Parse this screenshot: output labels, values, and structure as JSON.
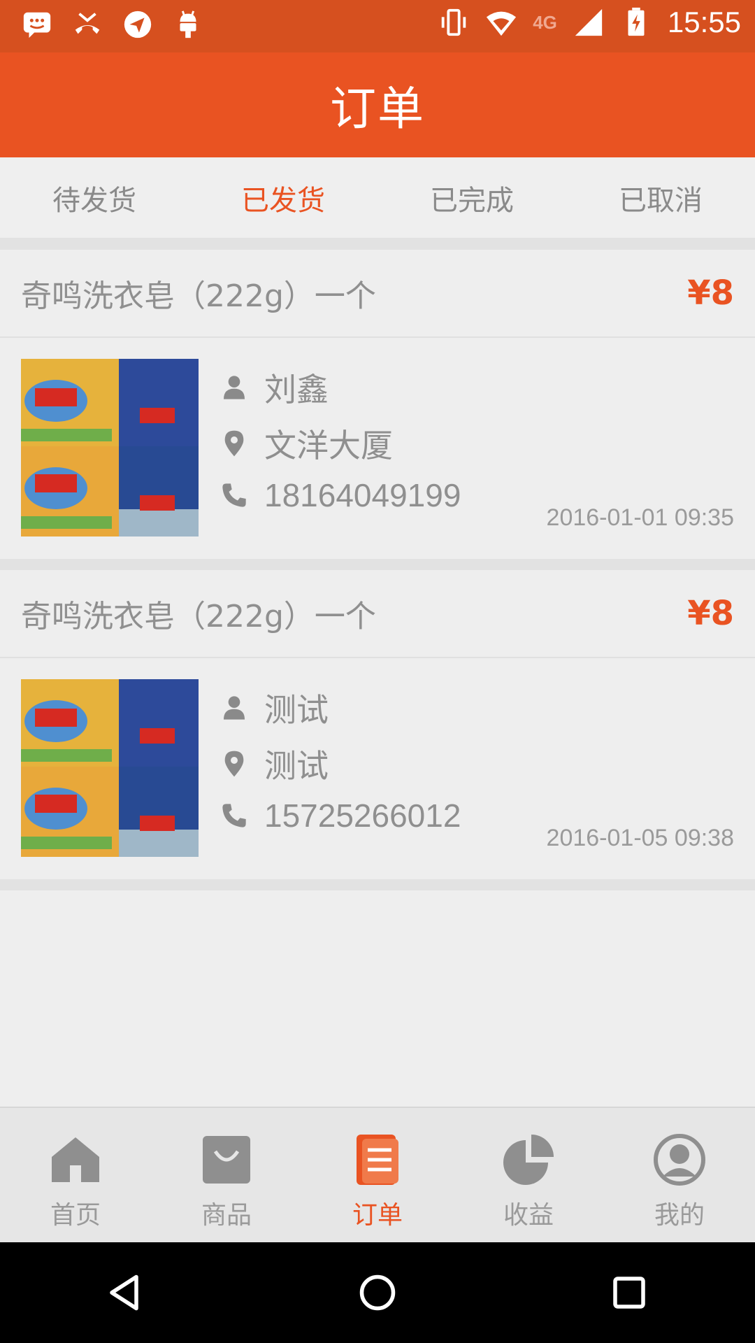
{
  "status_bar": {
    "time": "15:55",
    "network": "4G",
    "left_icons": [
      "message-icon",
      "missed-call-icon",
      "send-icon",
      "android-icon"
    ],
    "right_icons": [
      "vibrate-icon",
      "wifi-icon",
      "signal-icon",
      "battery-charging-icon"
    ]
  },
  "header": {
    "title": "订单"
  },
  "tabs": [
    {
      "label": "待发货",
      "active": false
    },
    {
      "label": "已发货",
      "active": true
    },
    {
      "label": "已完成",
      "active": false
    },
    {
      "label": "已取消",
      "active": false
    }
  ],
  "orders": [
    {
      "product": "奇鸣洗衣皂（222g）一个",
      "price": "¥8",
      "name": "刘鑫",
      "address": "文洋大厦",
      "phone": "18164049199",
      "date": "2016-01-01 09:35"
    },
    {
      "product": "奇鸣洗衣皂（222g）一个",
      "price": "¥8",
      "name": "测试",
      "address": "测试",
      "phone": "15725266012",
      "date": "2016-01-05 09:38"
    }
  ],
  "bottom_nav": [
    {
      "label": "首页",
      "icon": "home-icon",
      "active": false
    },
    {
      "label": "商品",
      "icon": "bag-icon",
      "active": false
    },
    {
      "label": "订单",
      "icon": "order-list-icon",
      "active": true
    },
    {
      "label": "收益",
      "icon": "pie-chart-icon",
      "active": false
    },
    {
      "label": "我的",
      "icon": "profile-icon",
      "active": false
    }
  ],
  "colors": {
    "accent": "#e95322",
    "status_bar": "#d6501f",
    "inactive": "#9a9a9a",
    "background": "#eeeeee"
  }
}
